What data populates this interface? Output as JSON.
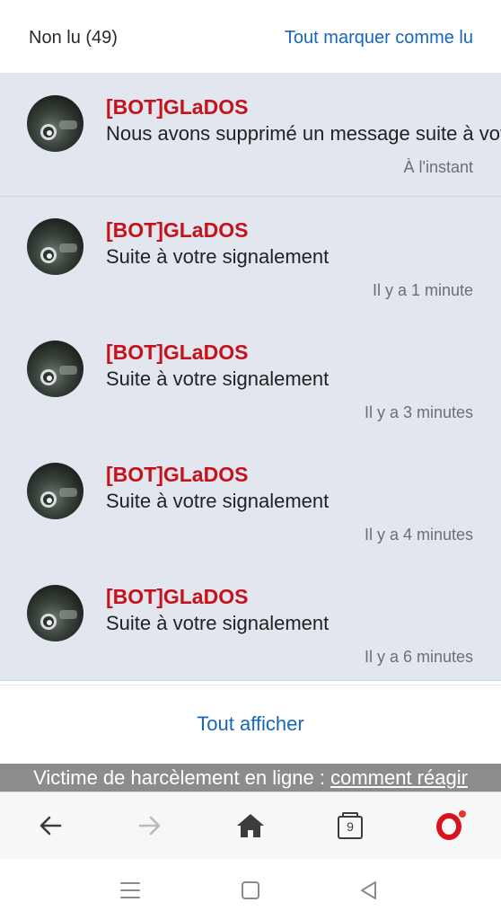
{
  "header": {
    "unread_label": "Non lu (49)",
    "mark_all_label": "Tout marquer comme lu"
  },
  "notifications": [
    {
      "author": "[BOT]GLaDOS",
      "message": "Nous avons supprimé un message suite à votre",
      "time": "À l'instant"
    },
    {
      "author": "[BOT]GLaDOS",
      "message": "Suite à votre signalement",
      "time": "Il y a 1 minute"
    },
    {
      "author": "[BOT]GLaDOS",
      "message": "Suite à votre signalement",
      "time": "Il y a 3 minutes"
    },
    {
      "author": "[BOT]GLaDOS",
      "message": "Suite à votre signalement",
      "time": "Il y a 4 minutes"
    },
    {
      "author": "[BOT]GLaDOS",
      "message": "Suite à votre signalement",
      "time": "Il y a 6 minutes"
    }
  ],
  "show_all_label": "Tout afficher",
  "banner": {
    "text": "Victime de harcèlement en ligne : ",
    "link": "comment réagir"
  },
  "browser_bar": {
    "tab_count": "9",
    "icons": [
      "back-arrow-icon",
      "forward-arrow-icon",
      "home-icon",
      "tabs-icon",
      "opera-icon"
    ]
  },
  "system_nav": {
    "icons": [
      "menu-icon",
      "home-square-icon",
      "back-triangle-icon"
    ]
  },
  "colors": {
    "author_red": "#c4131b",
    "link_blue": "#1766b8",
    "notif_bg": "#e2e6ef",
    "banner_gray": "#8c8c8c"
  }
}
